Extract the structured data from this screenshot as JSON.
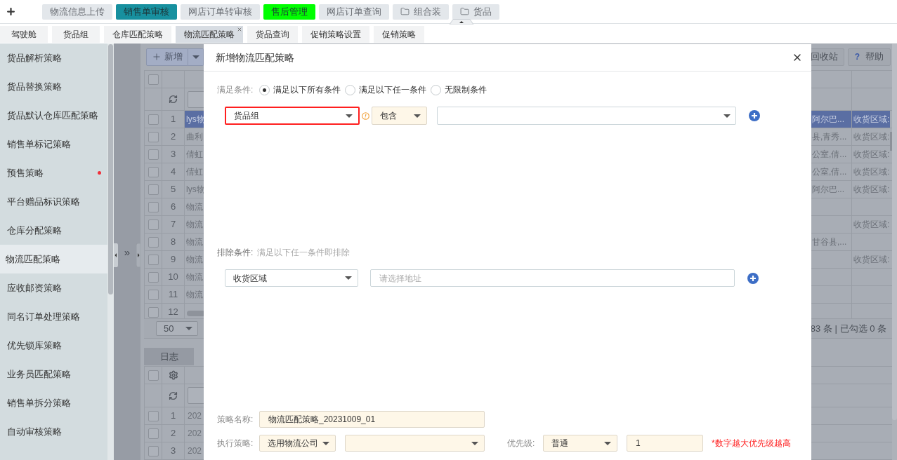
{
  "top_bar": {
    "nav_tabs": [
      {
        "label": "物流信息上传",
        "kind": "plain",
        "color": "#e3e7eb"
      },
      {
        "label": "销售单审核",
        "kind": "plain",
        "color": "#17909f"
      },
      {
        "label": "网店订单转审核",
        "kind": "plain",
        "color": "#e3e7eb"
      },
      {
        "label": "售后管理",
        "kind": "plain",
        "color": "#00ff00"
      },
      {
        "label": "网店订单查询",
        "kind": "plain",
        "color": "#e3e7eb"
      },
      {
        "label": "组合装",
        "kind": "folder",
        "color": "#e3e7eb"
      },
      {
        "label": "货品",
        "kind": "folder",
        "color": "#e3e7eb"
      }
    ]
  },
  "page_tabs": [
    {
      "label": "驾驶舱",
      "selected": false
    },
    {
      "label": "货品组",
      "selected": false
    },
    {
      "label": "仓库匹配策略",
      "selected": false
    },
    {
      "label": "物流匹配策略",
      "selected": true
    },
    {
      "label": "货品查询",
      "selected": false
    },
    {
      "label": "促销策略设置",
      "selected": false
    },
    {
      "label": "促销策略",
      "selected": false
    }
  ],
  "sidebar": {
    "items": [
      {
        "label": "货品解析策略",
        "selected": false,
        "notify": false
      },
      {
        "label": "货品替换策略",
        "selected": false,
        "notify": false
      },
      {
        "label": "货品默认仓库匹配策略",
        "selected": false,
        "notify": false
      },
      {
        "label": "销售单标记策略",
        "selected": false,
        "notify": false
      },
      {
        "label": "预售策略",
        "selected": false,
        "notify": true
      },
      {
        "label": "平台赠品标识策略",
        "selected": false,
        "notify": false
      },
      {
        "label": "仓库分配策略",
        "selected": false,
        "notify": false
      },
      {
        "label": "物流匹配策略",
        "selected": true,
        "notify": false
      },
      {
        "label": "应收邮资策略",
        "selected": false,
        "notify": false
      },
      {
        "label": "同名订单处理策略",
        "selected": false,
        "notify": false
      },
      {
        "label": "优先锁库策略",
        "selected": false,
        "notify": false
      },
      {
        "label": "业务员匹配策略",
        "selected": false,
        "notify": false
      },
      {
        "label": "销售单拆分策略",
        "selected": false,
        "notify": false
      },
      {
        "label": "自动审核策略",
        "selected": false,
        "notify": false
      }
    ]
  },
  "workspace": {
    "collapse_mark": "»",
    "toolbar": {
      "new_label": "新增",
      "recycle_label": "回收站",
      "help_mark": "?",
      "help_label": "帮助"
    },
    "table": {
      "header_checked": false,
      "rows": [
        {
          "no": "1",
          "checked": false,
          "selected": true,
          "col_1": "lys物",
          "col_2": "阿尔巴...",
          "col_3": "收货区域:"
        },
        {
          "no": "2",
          "checked": false,
          "selected": false,
          "col_1": "曲利",
          "col_2": "县,青秀...",
          "col_3": "收货区域:"
        },
        {
          "no": "3",
          "checked": false,
          "selected": false,
          "col_1": "倩虹",
          "col_2": "公室,倩...",
          "col_3": "收货区域:"
        },
        {
          "no": "4",
          "checked": false,
          "selected": false,
          "col_1": "倩虹",
          "col_2": "公室,倩...",
          "col_3": "收货区域:"
        },
        {
          "no": "5",
          "checked": false,
          "selected": false,
          "col_1": "lys物",
          "col_2": "阿尔巴...",
          "col_3": "收货区域:"
        },
        {
          "no": "6",
          "checked": false,
          "selected": false,
          "col_1": "物流"
        },
        {
          "no": "7",
          "checked": false,
          "selected": false,
          "col_1": "物流",
          "col_3": "收货区域:"
        },
        {
          "no": "8",
          "checked": false,
          "selected": false,
          "col_1": "物流",
          "col_2": "甘谷县,..."
        },
        {
          "no": "9",
          "checked": false,
          "selected": false,
          "col_1": "物流",
          "col_3": "收货区域:"
        },
        {
          "no": "10",
          "checked": false,
          "selected": false,
          "col_1": "物流"
        },
        {
          "no": "11",
          "checked": false,
          "selected": false,
          "col_1": "物流"
        },
        {
          "no": "12",
          "checked": false,
          "selected": false
        }
      ]
    },
    "pager": {
      "page_size": "50",
      "summary": "83 条 | 已勾选 0 条"
    },
    "log": {
      "tab": "日志",
      "header_checked": false,
      "rows": [
        {
          "no": "1",
          "checked": false,
          "col_1": "202"
        },
        {
          "no": "2",
          "checked": false,
          "col_1": "202"
        },
        {
          "no": "3",
          "checked": false,
          "col_1": "202"
        }
      ]
    }
  },
  "dialog": {
    "title": "新增物流匹配策略",
    "match": {
      "label": "满足条件:",
      "options": [
        {
          "label": "满足以下所有条件",
          "selected": true
        },
        {
          "label": "满足以下任一条件",
          "selected": false
        },
        {
          "label": "无限制条件",
          "selected": false
        }
      ]
    },
    "conditions": [
      {
        "field": "货品组",
        "highlighted": true,
        "operator": "包含"
      }
    ],
    "exclude": {
      "label": "排除条件:",
      "hint": "满足以下任一条件即排除",
      "rows": [
        {
          "field": "收货区域",
          "placeholder": "请选择地址"
        }
      ]
    },
    "name": {
      "label": "策略名称:",
      "value": "物流匹配策略_20231009_01"
    },
    "execution": {
      "label": "执行策略:",
      "mode": "选用物流公司"
    },
    "priority": {
      "label": "优先级:",
      "level_name": "普通",
      "value": "1",
      "note": "*数字越大优先级越高"
    }
  }
}
